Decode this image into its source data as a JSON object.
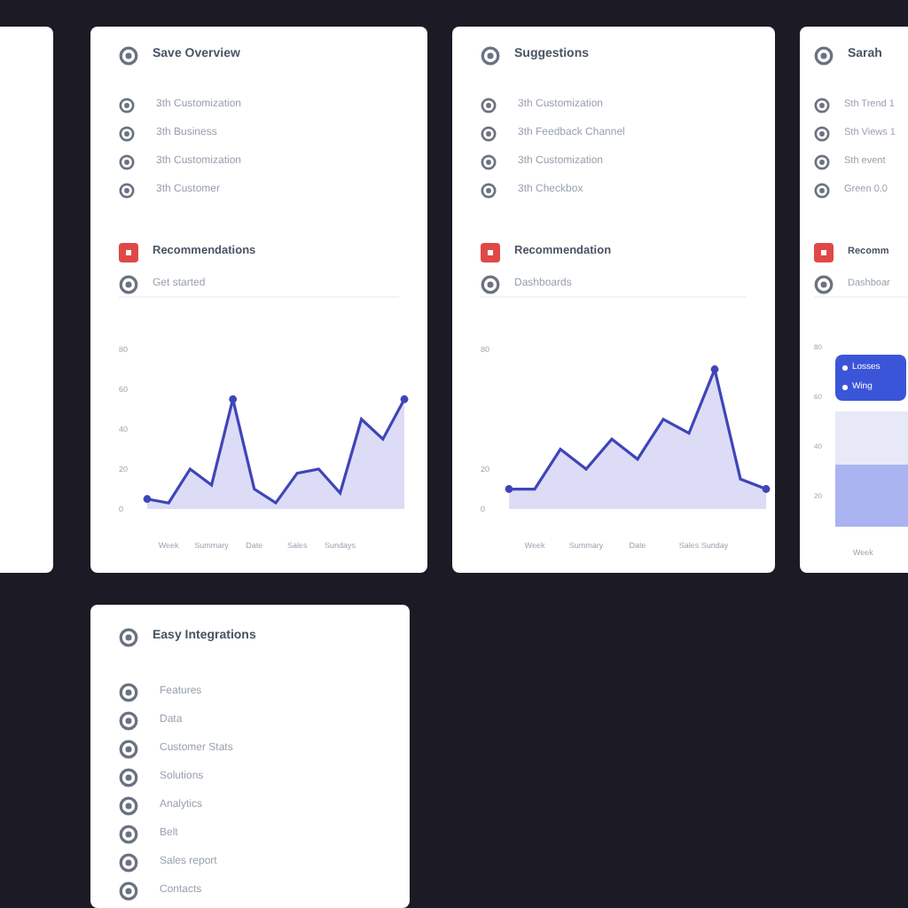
{
  "cards": [
    {
      "title": "Save Overview",
      "items": [
        "3th Customization",
        "3th Business",
        "3th Customization",
        "3th Customer"
      ],
      "section": "Recommendations",
      "action": "Get started",
      "chart": {
        "kind": "line",
        "chart_data": {
          "type": "area",
          "categories": [
            null,
            "Week",
            null,
            "Summary",
            null,
            "Date",
            null,
            "Sales",
            null,
            "Sundays",
            null,
            null,
            null
          ],
          "ylim": [
            0,
            80
          ],
          "yticks": [
            {
              "value": 0,
              "label": "0"
            },
            {
              "value": 20,
              "label": "20"
            },
            {
              "value": 40,
              "label": "40"
            },
            {
              "value": 60,
              "label": "60"
            },
            {
              "value": 80,
              "label": "80"
            }
          ],
          "values": [
            5,
            3,
            20,
            12,
            55,
            10,
            3,
            18,
            20,
            8,
            45,
            35,
            55
          ]
        }
      }
    },
    {
      "title": "Suggestions",
      "items": [
        "3th Customization",
        "3th Feedback Channel",
        "3th Customization",
        "3th Checkbox"
      ],
      "section": "Recommendation",
      "action": "Dashboards",
      "chart": {
        "kind": "line",
        "chart_data": {
          "type": "area",
          "categories": [
            null,
            "Week",
            null,
            "Summary",
            null,
            "Date",
            null,
            "Sales",
            "Sunday",
            null,
            null
          ],
          "ylim": [
            0,
            80
          ],
          "yticks": [
            {
              "value": 0,
              "label": "0"
            },
            {
              "value": 20,
              "label": "20"
            },
            {
              "value": 80,
              "label": "80"
            }
          ],
          "values": [
            10,
            10,
            30,
            20,
            35,
            25,
            45,
            38,
            70,
            15,
            10
          ]
        }
      }
    },
    {
      "title": "Sarah",
      "items": [
        "Sth Trend 1",
        "Sth Views 1",
        "Sth event",
        "Green 0.0"
      ],
      "section": "Recomm",
      "action": "Dashboar",
      "chart": {
        "kind": "bars",
        "yticks": [
          "80",
          "60",
          "40",
          "20"
        ],
        "xlabels": [
          "Week"
        ],
        "tooltip": [
          "Losses",
          "Wing"
        ]
      }
    }
  ],
  "bottom_card": {
    "title": "Easy Integrations",
    "items": [
      "Features",
      "Data",
      "Customer Stats",
      "Solutions",
      "Analytics",
      "Belt",
      "Sales report",
      "Contacts"
    ]
  }
}
